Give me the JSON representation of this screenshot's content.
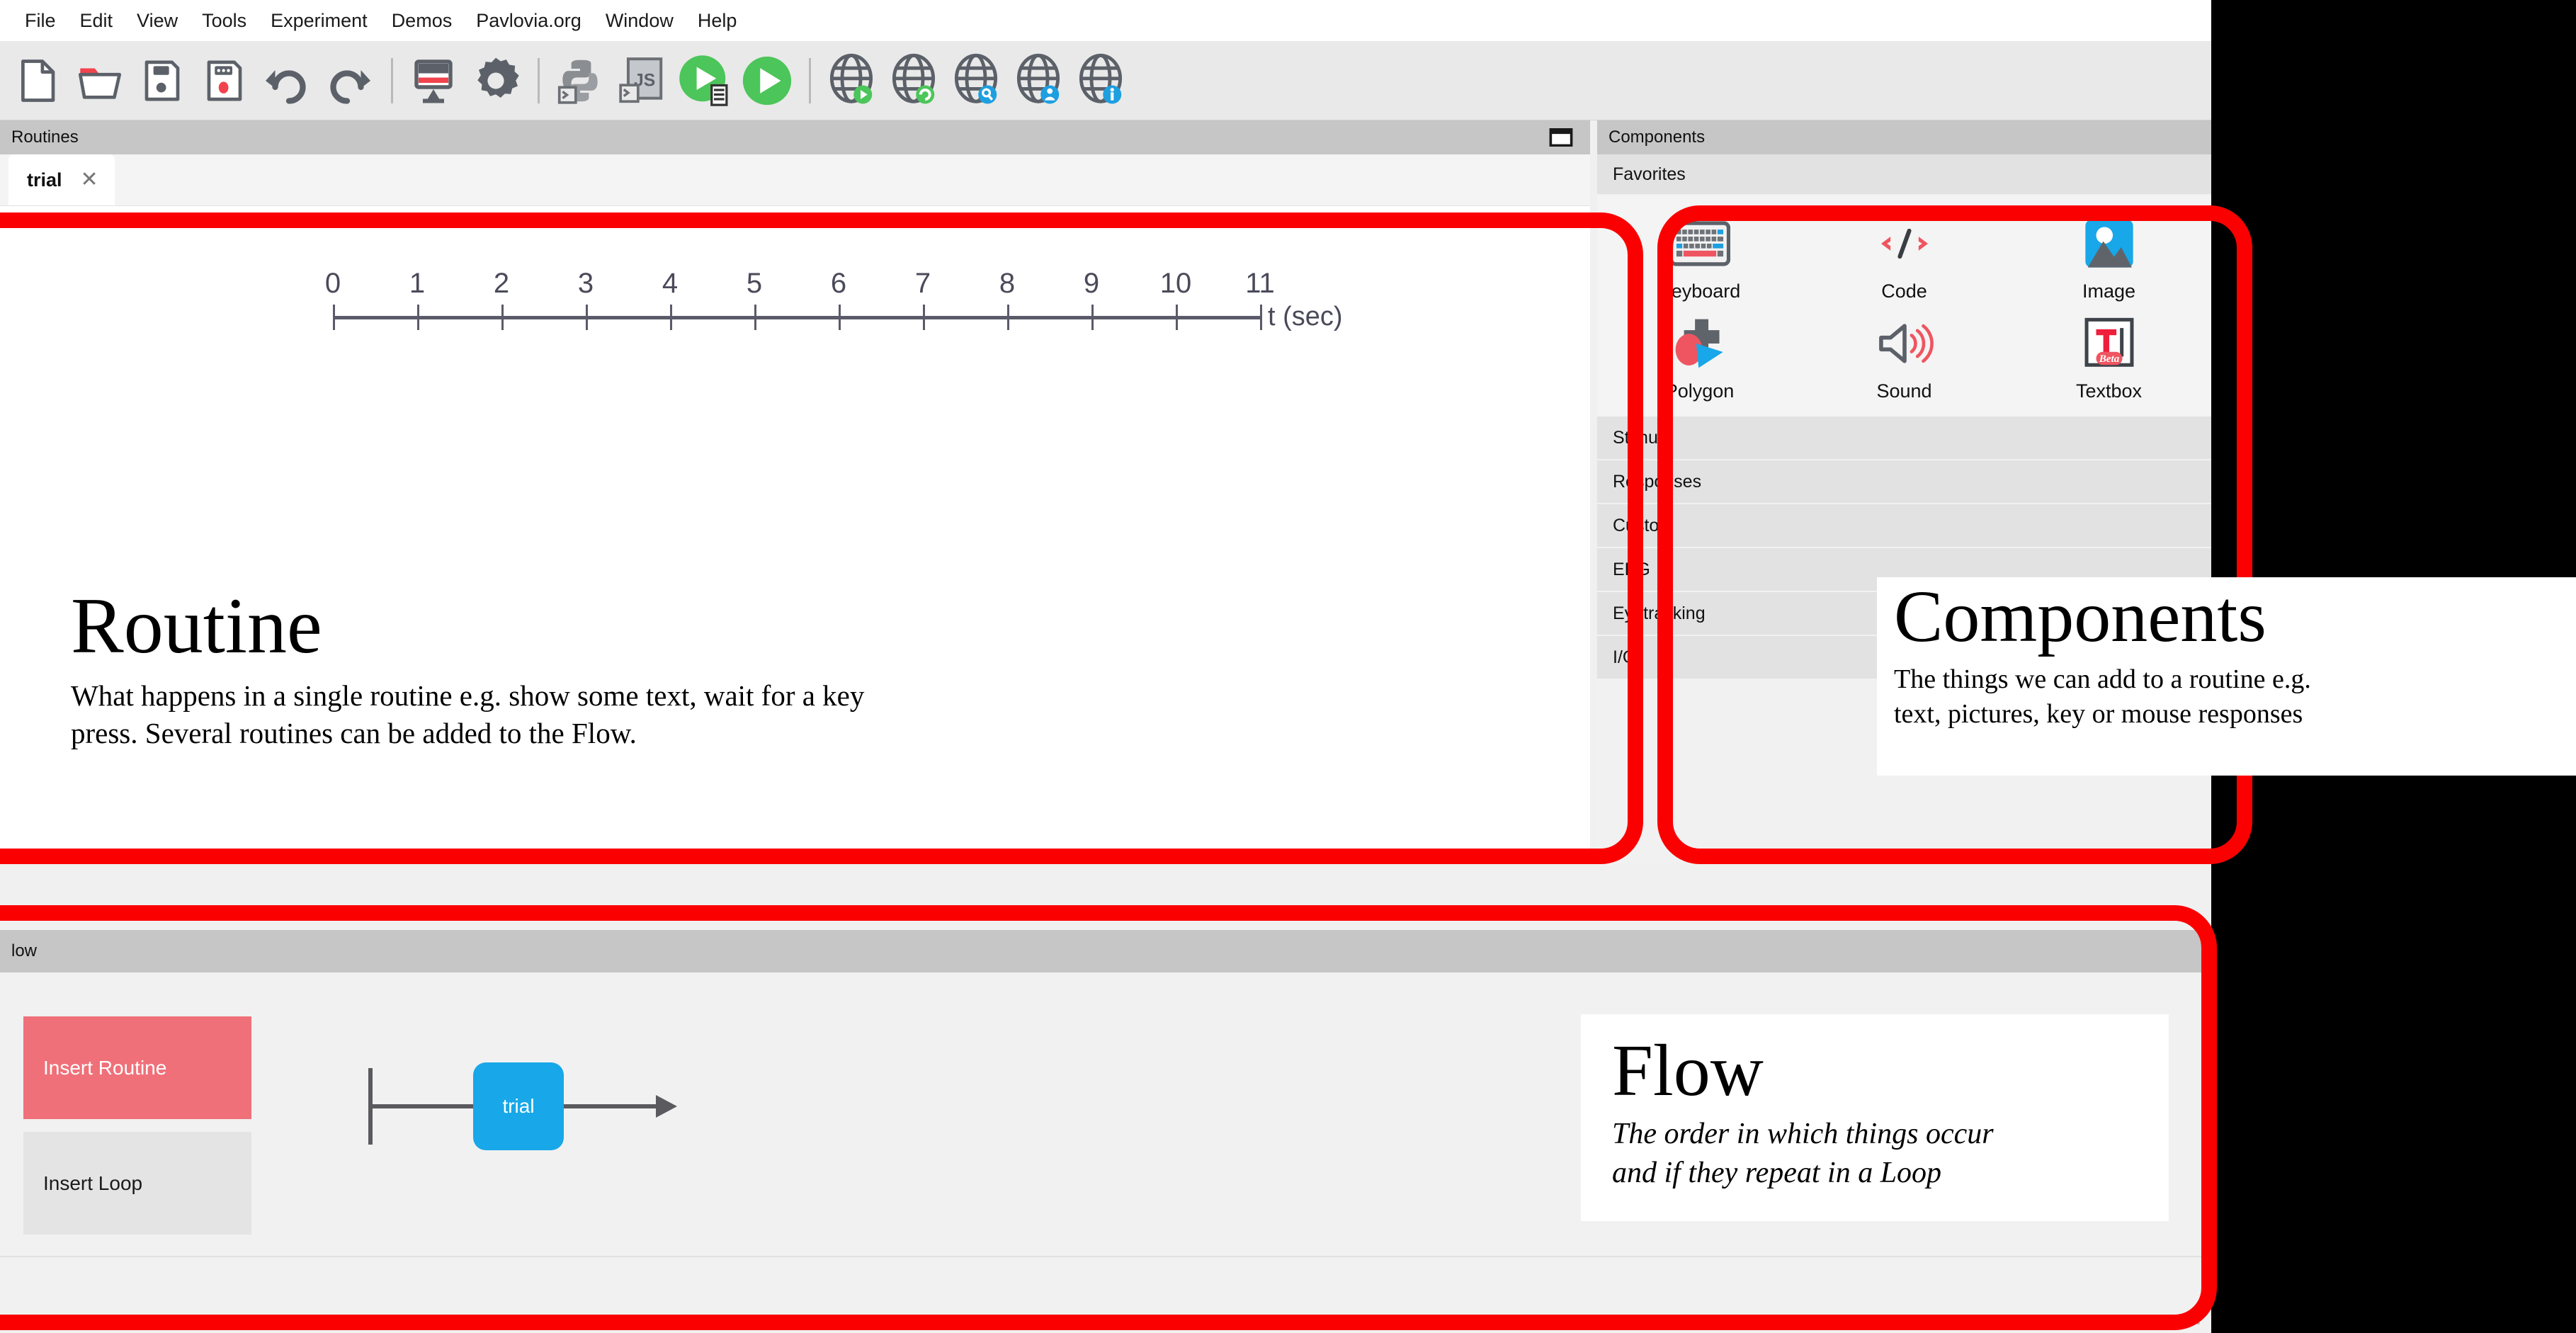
{
  "app": {
    "menubar": [
      {
        "label": "File"
      },
      {
        "label": "Edit"
      },
      {
        "label": "View"
      },
      {
        "label": "Tools"
      },
      {
        "label": "Experiment"
      },
      {
        "label": "Demos"
      },
      {
        "label": "Pavlovia.org"
      },
      {
        "label": "Window"
      },
      {
        "label": "Help"
      }
    ],
    "toolbar": [
      {
        "name": "new-file-icon"
      },
      {
        "name": "open-folder-icon"
      },
      {
        "name": "save-icon"
      },
      {
        "name": "save-as-icon"
      },
      {
        "name": "undo-icon"
      },
      {
        "name": "redo-icon"
      },
      {
        "name": "monitor-center-icon"
      },
      {
        "name": "settings-gear-icon"
      },
      {
        "name": "compile-python-icon"
      },
      {
        "name": "compile-js-icon"
      },
      {
        "name": "run-icon"
      },
      {
        "name": "run-online-icon"
      },
      {
        "name": "pavlovia-run-icon"
      },
      {
        "name": "pavlovia-sync-icon"
      },
      {
        "name": "pavlovia-search-icon"
      },
      {
        "name": "pavlovia-user-icon"
      },
      {
        "name": "pavlovia-info-icon"
      }
    ]
  },
  "routines": {
    "header_title": "Routines",
    "maximize_icon": "panel-restore-icon",
    "tab": {
      "label": "trial",
      "close_glyph": "✕"
    },
    "timeline": {
      "ticks": [
        "0",
        "1",
        "2",
        "3",
        "4",
        "5",
        "6",
        "7",
        "8",
        "9",
        "10",
        "11"
      ],
      "unit_label": "t (sec)"
    }
  },
  "components": {
    "header_title": "Components",
    "favorites_title": "Favorites",
    "favorites": [
      {
        "label": "Keyboard",
        "icon": "keyboard-icon"
      },
      {
        "label": "Code",
        "icon": "code-brackets-icon"
      },
      {
        "label": "Image",
        "icon": "image-icon"
      },
      {
        "label": "Polygon",
        "icon": "polygon-shapes-icon"
      },
      {
        "label": "Sound",
        "icon": "speaker-icon"
      },
      {
        "label": "Textbox",
        "icon": "textbox-beta-icon"
      }
    ],
    "categories": [
      {
        "label": "Stimuli"
      },
      {
        "label": "Responses"
      },
      {
        "label": "Custom"
      },
      {
        "label": "EEG"
      },
      {
        "label": "Eyetracking"
      },
      {
        "label": "I/O"
      }
    ]
  },
  "flow": {
    "header_title": "low",
    "insert_routine_label": "Insert Routine",
    "insert_loop_label": "Insert Loop",
    "routine_node_label": "trial"
  },
  "annotations": {
    "routine": {
      "title": "Routine",
      "body_line1": "What happens in a single routine e.g. show some text, wait for a key",
      "body_line2": "press. Several routines can be added to the Flow."
    },
    "components": {
      "title": "Components",
      "body_line1": "The things we can add to a routine e.g.",
      "body_line2": "text, pictures, key or mouse responses"
    },
    "flow": {
      "title": "Flow",
      "body_line1": "The order in which things occur",
      "body_line2": "and if they repeat in a Loop"
    }
  },
  "colors": {
    "annotation_red": "#fb0000",
    "insert_routine_red": "#ef7079",
    "flow_node_blue": "#18a7e8",
    "panel_header_gray": "#c6c6c6",
    "toolbar_gray": "#e9e9e9"
  }
}
